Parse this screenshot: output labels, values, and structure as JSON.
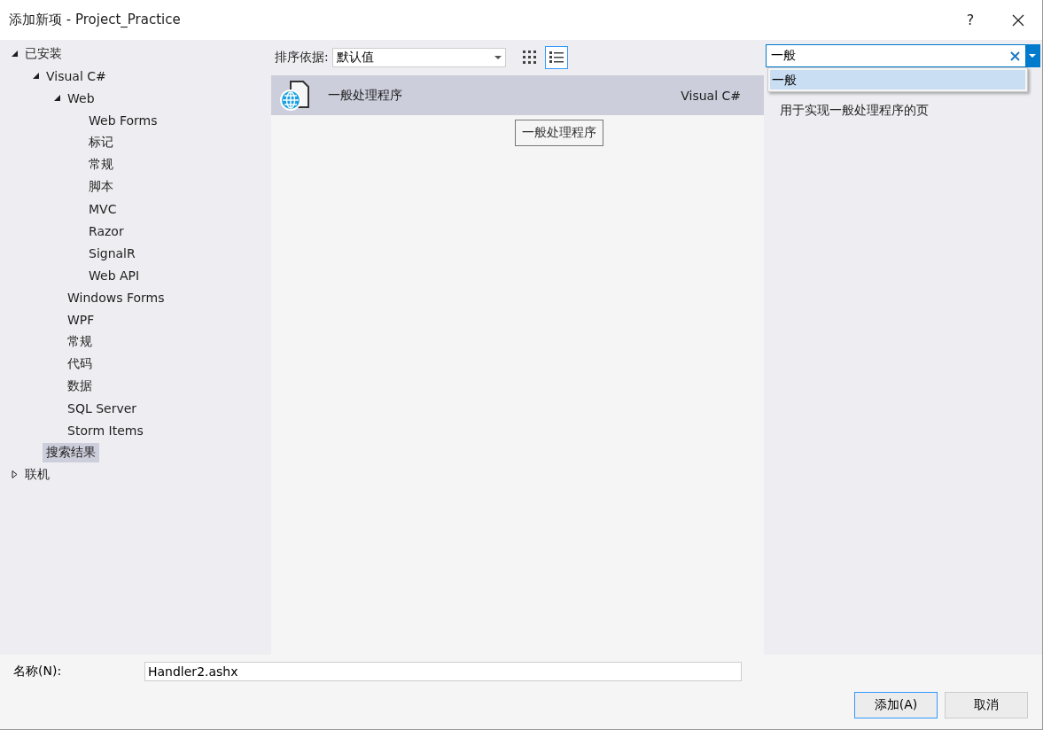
{
  "window": {
    "title": "添加新项 - Project_Practice",
    "help": "?"
  },
  "tree": [
    {
      "label": "已安装",
      "expanded": true,
      "selected": false,
      "children": [
        {
          "label": "Visual C#",
          "expanded": true,
          "selected": false,
          "children": [
            {
              "label": "Web",
              "expanded": true,
              "selected": false,
              "children": [
                {
                  "label": "Web Forms",
                  "selected": false
                },
                {
                  "label": "标记",
                  "selected": false
                },
                {
                  "label": "常规",
                  "selected": false
                },
                {
                  "label": "脚本",
                  "selected": false
                },
                {
                  "label": "MVC",
                  "selected": false
                },
                {
                  "label": "Razor",
                  "selected": false
                },
                {
                  "label": "SignalR",
                  "selected": false
                },
                {
                  "label": "Web API",
                  "selected": false
                }
              ]
            },
            {
              "label": "Windows Forms",
              "selected": false
            },
            {
              "label": "WPF",
              "selected": false
            },
            {
              "label": "常规",
              "selected": false
            },
            {
              "label": "代码",
              "selected": false
            },
            {
              "label": "数据",
              "selected": false
            },
            {
              "label": "SQL Server",
              "selected": false
            },
            {
              "label": "Storm Items",
              "selected": false
            }
          ]
        },
        {
          "label": "搜索结果",
          "selected": true
        }
      ]
    },
    {
      "label": "联机",
      "expanded": false,
      "selected": false
    }
  ],
  "sort": {
    "label": "排序依据:",
    "value": "默认值"
  },
  "view_buttons": [
    {
      "kind": "grid",
      "selected": false
    },
    {
      "kind": "list",
      "selected": true
    }
  ],
  "templates": [
    {
      "name": "一般处理程序",
      "language": "Visual C#",
      "selected": true
    }
  ],
  "tooltip": "一般处理程序",
  "search": {
    "value": "一般",
    "suggestions": [
      {
        "label": "一般",
        "selected": true
      }
    ]
  },
  "description": "用于实现一般处理程序的页",
  "name_field": {
    "label": "名称(N):",
    "value": "Handler2.ashx"
  },
  "buttons": [
    {
      "label": "添加(A)",
      "primary": true
    },
    {
      "label": "取消",
      "primary": false
    }
  ]
}
